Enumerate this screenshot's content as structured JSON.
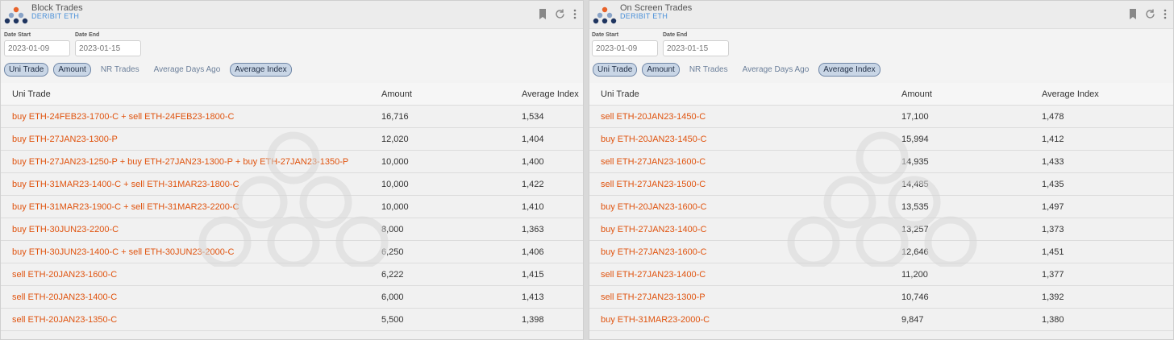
{
  "panels": [
    {
      "title": "Block Trades",
      "subtitle": "DERIBIT ETH",
      "date_start_label": "Date Start",
      "date_start": "2023-01-09",
      "date_end_label": "Date End",
      "date_end": "2023-01-15",
      "tabs": [
        {
          "label": "Uni Trade",
          "active": true
        },
        {
          "label": "Amount",
          "active": true
        },
        {
          "label": "NR Trades",
          "active": false
        },
        {
          "label": "Average Days Ago",
          "active": false
        },
        {
          "label": "Average Index",
          "active": true
        }
      ],
      "columns": [
        "Uni Trade",
        "Amount",
        "Average Index"
      ],
      "rows": [
        {
          "trade": "buy ETH-24FEB23-1700-C + sell ETH-24FEB23-1800-C",
          "amount": "16,716",
          "avg": "1,534"
        },
        {
          "trade": "buy ETH-27JAN23-1300-P",
          "amount": "12,020",
          "avg": "1,404"
        },
        {
          "trade": "buy ETH-27JAN23-1250-P + buy ETH-27JAN23-1300-P + buy ETH-27JAN23-1350-P",
          "amount": "10,000",
          "avg": "1,400"
        },
        {
          "trade": "buy ETH-31MAR23-1400-C + sell ETH-31MAR23-1800-C",
          "amount": "10,000",
          "avg": "1,422"
        },
        {
          "trade": "buy ETH-31MAR23-1900-C + sell ETH-31MAR23-2200-C",
          "amount": "10,000",
          "avg": "1,410"
        },
        {
          "trade": "buy ETH-30JUN23-2200-C",
          "amount": "8,000",
          "avg": "1,363"
        },
        {
          "trade": "buy ETH-30JUN23-1400-C + sell ETH-30JUN23-2000-C",
          "amount": "6,250",
          "avg": "1,406"
        },
        {
          "trade": "sell ETH-20JAN23-1600-C",
          "amount": "6,222",
          "avg": "1,415"
        },
        {
          "trade": "sell ETH-20JAN23-1400-C",
          "amount": "6,000",
          "avg": "1,413"
        },
        {
          "trade": "sell ETH-20JAN23-1350-C",
          "amount": "5,500",
          "avg": "1,398"
        }
      ]
    },
    {
      "title": "On Screen Trades",
      "subtitle": "DERIBIT ETH",
      "date_start_label": "Date Start",
      "date_start": "2023-01-09",
      "date_end_label": "Date End",
      "date_end": "2023-01-15",
      "tabs": [
        {
          "label": "Uni Trade",
          "active": true
        },
        {
          "label": "Amount",
          "active": true
        },
        {
          "label": "NR Trades",
          "active": false
        },
        {
          "label": "Average Days Ago",
          "active": false
        },
        {
          "label": "Average Index",
          "active": true
        }
      ],
      "columns": [
        "Uni Trade",
        "Amount",
        "Average Index"
      ],
      "rows": [
        {
          "trade": "sell ETH-20JAN23-1450-C",
          "amount": "17,100",
          "avg": "1,478"
        },
        {
          "trade": "buy ETH-20JAN23-1450-C",
          "amount": "15,994",
          "avg": "1,412"
        },
        {
          "trade": "sell ETH-27JAN23-1600-C",
          "amount": "14,935",
          "avg": "1,433"
        },
        {
          "trade": "sell ETH-27JAN23-1500-C",
          "amount": "14,485",
          "avg": "1,435"
        },
        {
          "trade": "buy ETH-20JAN23-1600-C",
          "amount": "13,535",
          "avg": "1,497"
        },
        {
          "trade": "buy ETH-27JAN23-1400-C",
          "amount": "13,257",
          "avg": "1,373"
        },
        {
          "trade": "buy ETH-27JAN23-1600-C",
          "amount": "12,646",
          "avg": "1,451"
        },
        {
          "trade": "sell ETH-27JAN23-1400-C",
          "amount": "11,200",
          "avg": "1,377"
        },
        {
          "trade": "sell ETH-27JAN23-1300-P",
          "amount": "10,746",
          "avg": "1,392"
        },
        {
          "trade": "buy ETH-31MAR23-2000-C",
          "amount": "9,847",
          "avg": "1,380"
        }
      ]
    }
  ],
  "icons": [
    "logo-icon",
    "bookmark-icon",
    "refresh-icon",
    "more-vertical-icon"
  ],
  "colors": {
    "accent_trade": "#e0530e",
    "subtitle": "#4a90d9",
    "tab_active_bg": "#c9d6e6"
  }
}
